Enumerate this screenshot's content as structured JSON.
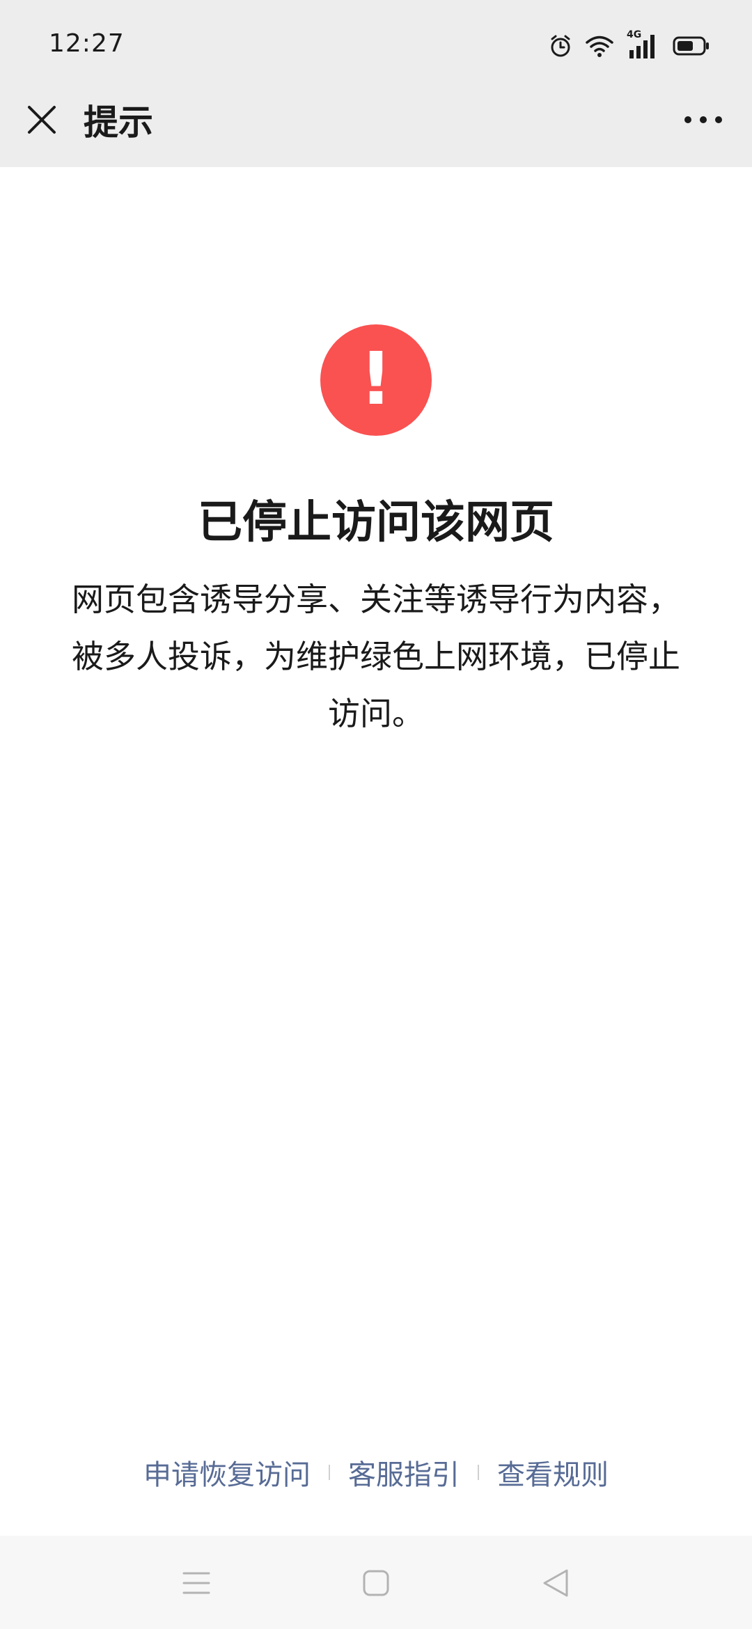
{
  "status_bar": {
    "time": "12:27",
    "network_label": "4G",
    "icons": [
      "alarm-icon",
      "wifi-icon",
      "cellular-signal-icon",
      "battery-icon"
    ]
  },
  "title_bar": {
    "title": "提示",
    "close_icon": "close-icon",
    "more_icon": "more-icon"
  },
  "content": {
    "alert_symbol": "!",
    "alert_color": "#fa5151",
    "heading": "已停止访问该网页",
    "message": "网页包含诱导分享、关注等诱导行为内容，被多人投诉，为维护绿色上网环境，已停止访问。"
  },
  "footer": {
    "links": [
      "申请恢复访问",
      "客服指引",
      "查看规则"
    ],
    "link_color": "#576b95"
  },
  "nav_bar": {
    "icons": [
      "menu-icon",
      "home-icon",
      "back-icon"
    ]
  }
}
